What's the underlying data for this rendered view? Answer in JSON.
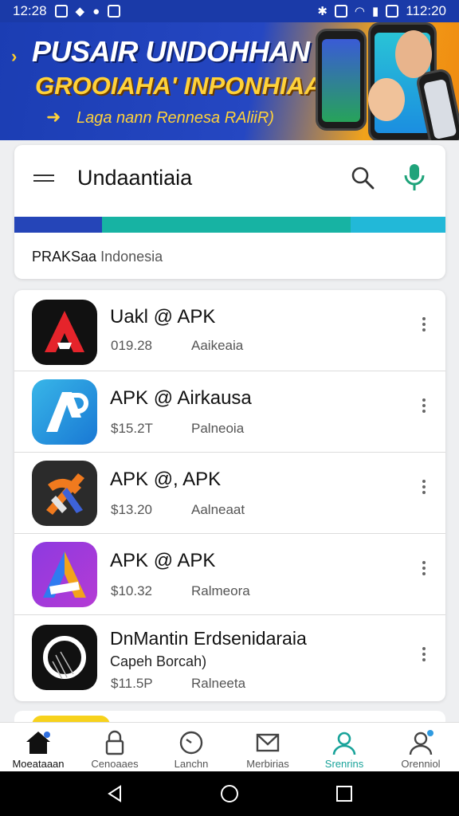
{
  "status_bar": {
    "time_left": "12:28",
    "time_right": "112:20"
  },
  "banner": {
    "title_line1": "PUSAIR UNDOHHAN",
    "title_line2": "GROOIAHA' INPONHIAA",
    "subtitle": "Laga nann Rennesa RAliiR)"
  },
  "search": {
    "title": "Undaantiaia",
    "region_bold": "PRAKSaa",
    "region_rest": "Indonesia",
    "colorbar": [
      "#2545b8",
      "#17b3a3",
      "#22b8d8"
    ]
  },
  "apps": [
    {
      "name": "Uakl @ APK",
      "sub": "",
      "size": "019.28",
      "category": "Aaikeaia",
      "icon": "red-a-icon"
    },
    {
      "name": "APK @ Airkausa",
      "sub": "",
      "size": "$15.2T",
      "category": "Palneoia",
      "icon": "blue-ap-icon"
    },
    {
      "name": "APK @, APK",
      "sub": "",
      "size": "$13.20",
      "category": "Aalneaat",
      "icon": "orange-x-icon"
    },
    {
      "name": "APK @ APK",
      "sub": "",
      "size": "$10.32",
      "category": "Ralmeora",
      "icon": "purple-a-icon"
    },
    {
      "name": "DnMantin Erdsenidaraia",
      "sub": "Capeh Borcah)",
      "size": "$11.5P",
      "category": "Ralneeta",
      "icon": "black-circle-icon"
    }
  ],
  "bottom_nav": [
    {
      "label": "Moeataaan",
      "icon": "home-icon",
      "active": false
    },
    {
      "label": "Cenoaaes",
      "icon": "lock-icon",
      "active": false
    },
    {
      "label": "Lanchn",
      "icon": "clock-icon",
      "active": false
    },
    {
      "label": "Merbirias",
      "icon": "mail-icon",
      "active": false
    },
    {
      "label": "Srenrins",
      "icon": "user-icon",
      "active": true
    },
    {
      "label": "Orenniol",
      "icon": "account-icon",
      "active": false
    }
  ]
}
